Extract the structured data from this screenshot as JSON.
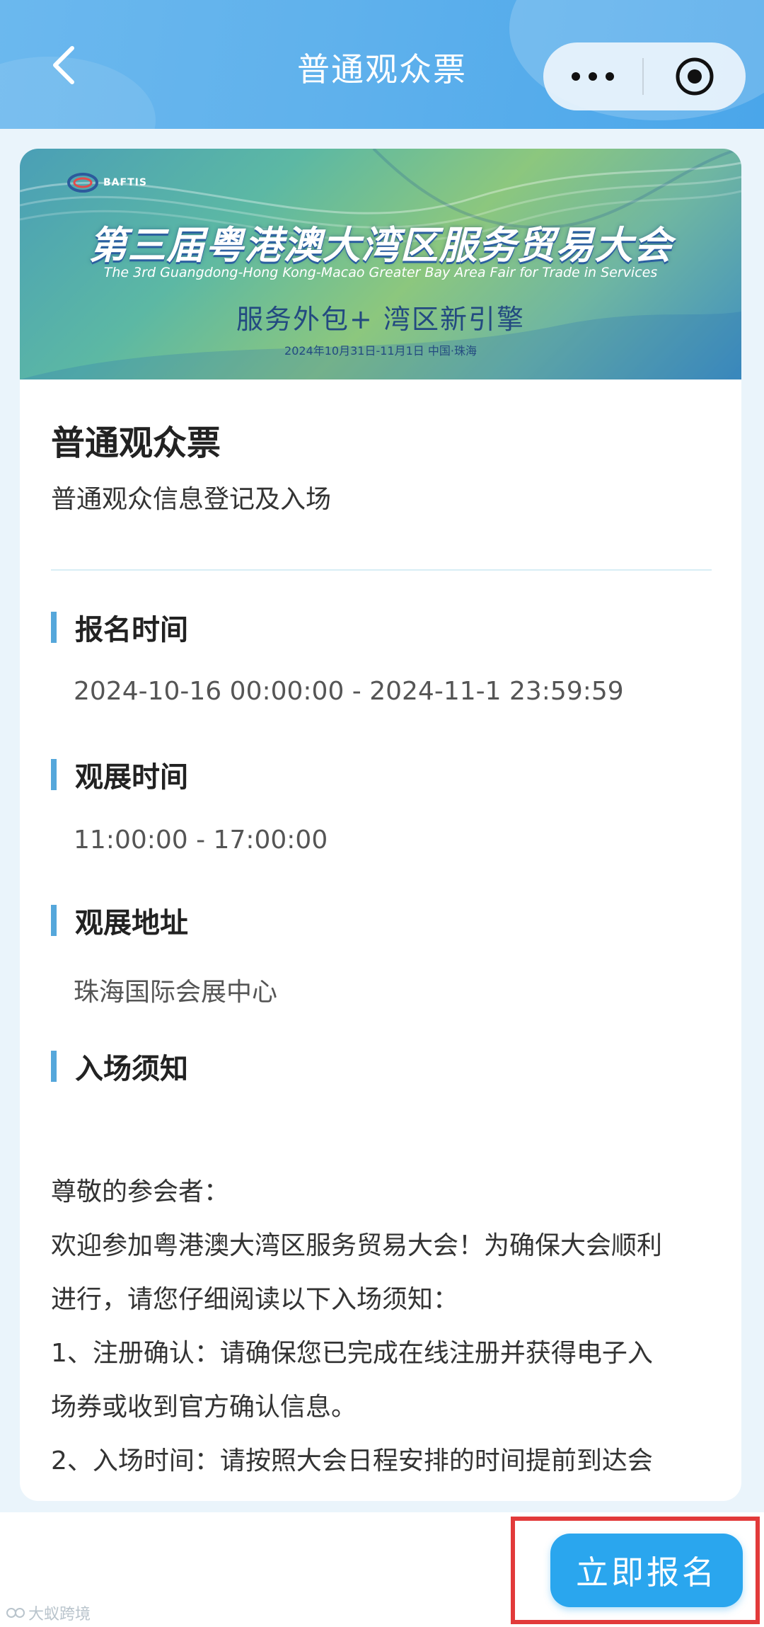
{
  "nav": {
    "title": "普通观众票"
  },
  "banner": {
    "logo_text": "BAFTIS",
    "headline": "第三届粤港澳大湾区服务贸易大会",
    "subline": "The 3rd Guangdong-Hong Kong-Macao Greater Bay Area Fair for Trade in Services",
    "slogan": "服务外包+  湾区新引擎",
    "dateline": "2024年10月31日-11月1日    中国·珠海"
  },
  "ticket": {
    "title": "普通观众票",
    "description": "普通观众信息登记及入场"
  },
  "sections": [
    {
      "label": "报名时间",
      "value": "2024-10-16 00:00:00 - 2024-11-1 23:59:59"
    },
    {
      "label": "观展时间",
      "value": "11:00:00 - 17:00:00"
    },
    {
      "label": "观展地址",
      "value": "珠海国际会展中心"
    },
    {
      "label": "入场须知"
    }
  ],
  "notice": {
    "greeting": "尊敬的参会者：",
    "intro_line1": "欢迎参加粤港澳大湾区服务贸易大会！为确保大会顺利",
    "intro_line2": "进行，请您仔细阅读以下入场须知：",
    "item1_line1": "1、注册确认：请确保您已完成在线注册并获得电子入",
    "item1_line2": "场券或收到官方确认信息。",
    "item2_line1": "2、入场时间：请按照大会日程安排的时间提前到达会"
  },
  "footer": {
    "register_label": "立即报名",
    "watermark": "大蚁跨境"
  },
  "colors": {
    "accent": "#2aa6ee",
    "section_bar": "#55a7db",
    "highlight": "#e23a3a"
  }
}
